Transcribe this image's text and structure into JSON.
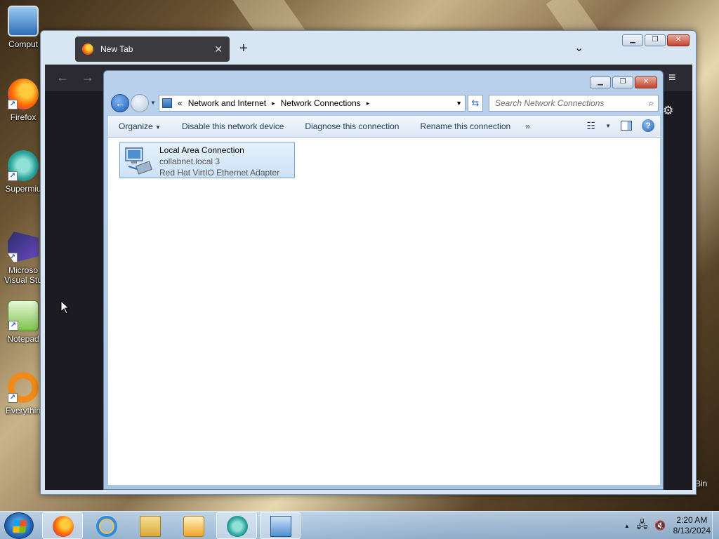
{
  "desktop": {
    "icons": [
      {
        "label": "Comput",
        "icon": "computer-icon"
      },
      {
        "label": "Firefox",
        "icon": "firefox-icon"
      },
      {
        "label": "Supermiu",
        "icon": "supermium-icon"
      },
      {
        "label": "Microso",
        "label2": "Visual Stu",
        "icon": "visual-studio-icon"
      },
      {
        "label": "Notepad",
        "icon": "notepad-icon"
      },
      {
        "label": "Everythin",
        "icon": "everything-icon"
      }
    ],
    "partial_label_right": "Bin"
  },
  "firefox": {
    "tab_title": "New Tab",
    "tab_close": "✕",
    "new_tab": "+",
    "tab_list": "⌄",
    "nav_back": "←",
    "nav_forward": "→",
    "menu": "≡",
    "settings": "⚙"
  },
  "explorer": {
    "breadcrumb": {
      "overflow": "«",
      "items": [
        "Network and Internet",
        "Network Connections"
      ],
      "separator": "▸"
    },
    "search_placeholder": "Search Network Connections",
    "toolbar": {
      "organize": "Organize",
      "disable": "Disable this network device",
      "diagnose": "Diagnose this connection",
      "rename": "Rename this connection",
      "more": "»",
      "help": "?"
    },
    "connection": {
      "name": "Local Area Connection",
      "network": "collabnet.local  3",
      "adapter": "Red Hat VirtIO Ethernet Adapter"
    }
  },
  "taskbar": {
    "time": "2:20 AM",
    "date": "8/13/2024",
    "pinned": [
      "firefox-icon",
      "internet-explorer-icon",
      "file-explorer-icon",
      "media-player-icon",
      "supermium-icon",
      "network-connections-icon"
    ],
    "tray_expand": "▲"
  },
  "colors": {
    "explorer_chrome": "#b9d1ea",
    "toolbar_text": "#1e395b",
    "selection": "#cde2f8",
    "firefox_dark": "#1c1b22"
  }
}
